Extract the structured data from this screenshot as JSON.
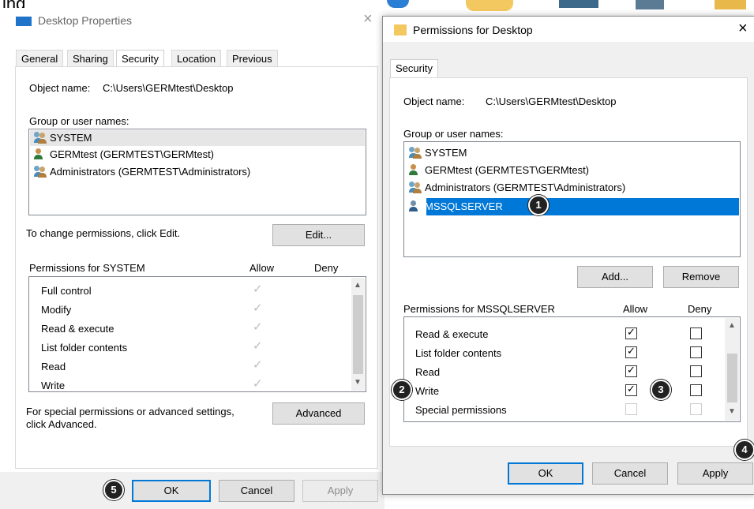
{
  "top_text": "ing",
  "desktop_props": {
    "title": "Desktop Properties",
    "close": "×",
    "tabs": [
      "General",
      "Sharing",
      "Security",
      "Location",
      "Previous Versions"
    ],
    "object_name_label": "Object name:",
    "object_name_value": "C:\\Users\\GERMtest\\Desktop",
    "group_label": "Group or user names:",
    "users": [
      "SYSTEM",
      "GERMtest (GERMTEST\\GERMtest)",
      "Administrators (GERMTEST\\Administrators)"
    ],
    "change_text": "To change permissions, click Edit.",
    "edit_button": "Edit...",
    "perm_header": "Permissions for SYSTEM",
    "allow_header": "Allow",
    "deny_header": "Deny",
    "permissions": [
      "Full control",
      "Modify",
      "Read & execute",
      "List folder contents",
      "Read",
      "Write"
    ],
    "special_text_1": "For special permissions or advanced settings,",
    "special_text_2": "click Advanced.",
    "advanced_button": "Advanced",
    "ok_button": "OK",
    "cancel_button": "Cancel",
    "apply_button": "Apply"
  },
  "perm_dialog": {
    "title": "Permissions for Desktop",
    "close": "×",
    "tab": "Security",
    "object_name_label": "Object name:",
    "object_name_value": "C:\\Users\\GERMtest\\Desktop",
    "group_label": "Group or user names:",
    "users": [
      "SYSTEM",
      "GERMtest (GERMTEST\\GERMtest)",
      "Administrators (GERMTEST\\Administrators)",
      "MSSQLSERVER"
    ],
    "add_button": "Add...",
    "remove_button": "Remove",
    "perm_header": "Permissions for MSSQLSERVER",
    "allow_header": "Allow",
    "deny_header": "Deny",
    "permissions": [
      {
        "name": "Read & execute",
        "allow": true,
        "deny": false
      },
      {
        "name": "List folder contents",
        "allow": true,
        "deny": false
      },
      {
        "name": "Read",
        "allow": true,
        "deny": false
      },
      {
        "name": "Write",
        "allow": true,
        "deny": false
      },
      {
        "name": "Special permissions",
        "allow": false,
        "deny": false
      }
    ],
    "ok_button": "OK",
    "cancel_button": "Cancel",
    "apply_button": "Apply"
  },
  "badges": [
    "1",
    "2",
    "3",
    "4",
    "5"
  ],
  "colors": {
    "selection": "#0078d7",
    "selection_light": "#cce8ff"
  }
}
